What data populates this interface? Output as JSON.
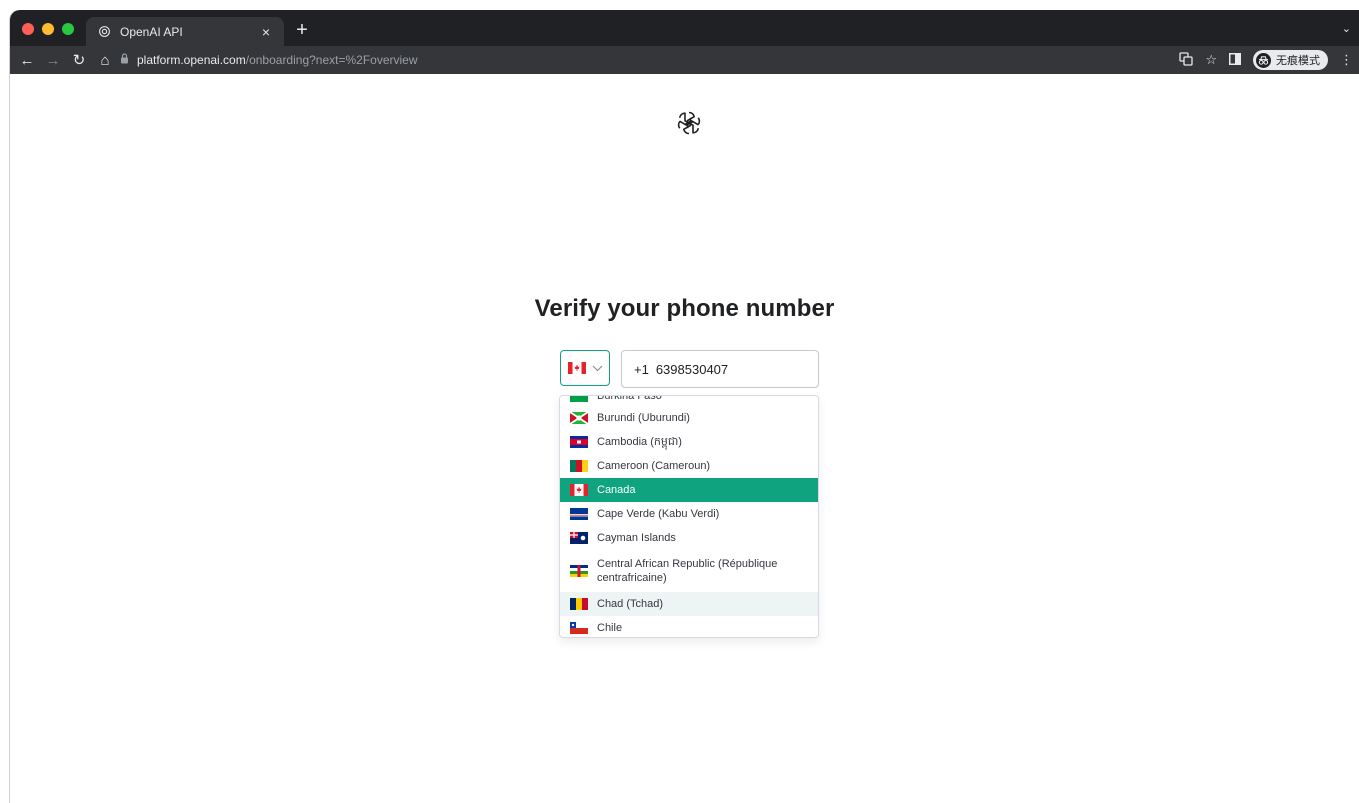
{
  "browser": {
    "tab_title": "OpenAI API",
    "new_tab_symbol": "+",
    "tab_close_symbol": "×",
    "url_host": "platform.openai.com",
    "url_path": "/onboarding?next=%2Foverview",
    "incognito_label": "无痕模式",
    "icons": [
      "back-icon",
      "forward-icon",
      "reload-icon",
      "home-icon",
      "lock-icon",
      "translate-icon",
      "star-icon",
      "side-panel-icon",
      "incognito-icon",
      "menu-icon"
    ]
  },
  "page": {
    "logo": "openai-logo",
    "heading": "Verify your phone number",
    "selected_country_flag": "canada-flag",
    "phone_prefix": "+1",
    "phone_value": "6398530407"
  },
  "dropdown": {
    "options": [
      {
        "label": "Burkina Faso",
        "state": "partially-visible"
      },
      {
        "label": "Burundi (Uburundi)",
        "state": "normal"
      },
      {
        "label": "Cambodia (កម្ពុជា)",
        "state": "normal"
      },
      {
        "label": "Cameroon (Cameroun)",
        "state": "normal"
      },
      {
        "label": "Canada",
        "state": "selected"
      },
      {
        "label": "Cape Verde (Kabu Verdi)",
        "state": "normal"
      },
      {
        "label": "Cayman Islands",
        "state": "normal"
      },
      {
        "label": "Central African Republic (République centrafricaine)",
        "state": "normal"
      },
      {
        "label": "Chad (Tchad)",
        "state": "hovered"
      },
      {
        "label": "Chile",
        "state": "normal"
      }
    ]
  },
  "colors": {
    "accent": "#10a37f",
    "hover": "#ecf4f4",
    "chrome_dark": "#202124",
    "chrome_toolbar": "#35363a"
  }
}
